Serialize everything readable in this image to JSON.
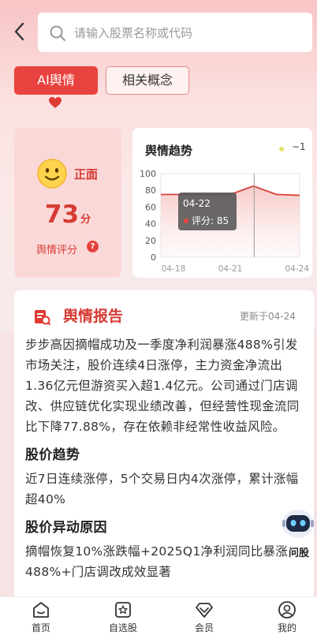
{
  "header": {
    "back_icon": "chevron-left-icon",
    "search_icon": "search-icon",
    "search_placeholder": "请输入股票名称或代码"
  },
  "tabs": [
    {
      "label": "AI舆情",
      "active": true
    },
    {
      "label": "相关概念",
      "active": false
    }
  ],
  "score_card": {
    "sentiment": "正面",
    "score": "73",
    "unit": "分",
    "label": "舆情评分",
    "help": "?"
  },
  "trend_card": {
    "title": "舆情趋势",
    "legend": "−1"
  },
  "chart_data": {
    "type": "line",
    "title": "舆情趋势",
    "x_ticks": [
      "04-18",
      "04-21",
      "04-24"
    ],
    "y_ticks": [
      0,
      20,
      40,
      60,
      80,
      100
    ],
    "ylim": [
      0,
      100
    ],
    "x": [
      "04-18",
      "04-19",
      "04-20",
      "04-21",
      "04-22",
      "04-23",
      "04-24"
    ],
    "values": [
      75,
      75,
      75,
      75,
      85,
      75,
      74
    ],
    "tooltip": {
      "date": "04-22",
      "text": "评分: 85"
    },
    "line_color": "#d9433d"
  },
  "report": {
    "title": "舆情报告",
    "updated": "更新于04-24",
    "summary": "步步高因摘帽成功及一季度净利润暴涨488%引发市场关注，股价连续4日涨停，主力资金净流出1.36亿元但游资买入超1.4亿元。公司通过门店调改、供应链优化实现业绩改善，但经营性现金流同比下降77.88%，存在依赖非经常性收益风险。",
    "section1_title": "股价趋势",
    "section1_text": "近7日连续涨停，5个交易日内4次涨停，累计涨幅超40%",
    "section2_title": "股价异动原因",
    "section2_text": "摘帽恢复10%涨跌幅+2025Q1净利润同比暴涨488%+门店调改成效显著"
  },
  "assistant": {
    "label": "问股"
  },
  "nav": [
    {
      "label": "首页",
      "icon": "home-icon"
    },
    {
      "label": "自选股",
      "icon": "star-icon"
    },
    {
      "label": "会员",
      "icon": "diamond-icon"
    },
    {
      "label": "我的",
      "icon": "user-icon"
    }
  ]
}
